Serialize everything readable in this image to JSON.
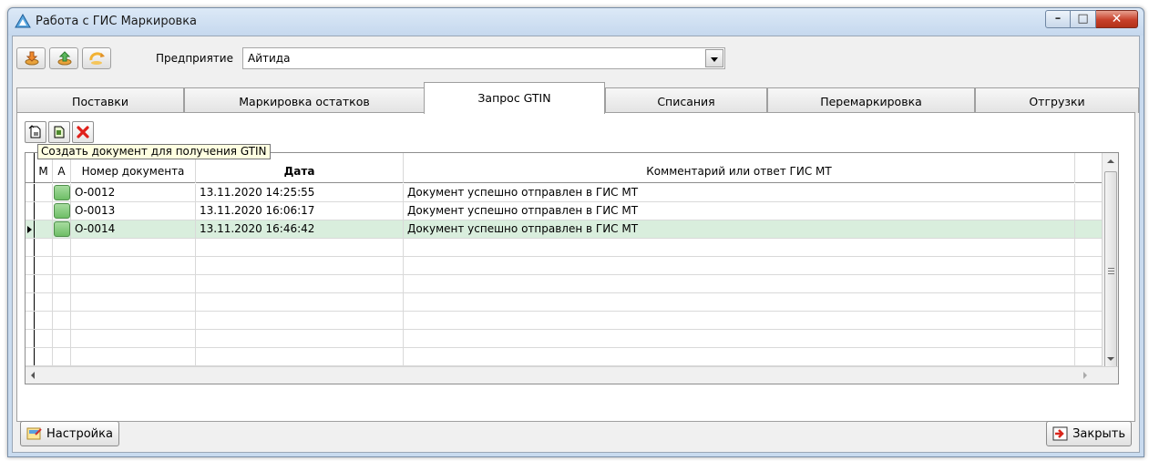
{
  "window": {
    "title": "Работа с ГИС Маркировка",
    "controls": [
      "minimize-icon",
      "maximize-icon",
      "close-icon"
    ]
  },
  "toolbar": {
    "buttons": [
      "download-icon",
      "upload-icon",
      "refresh-icon"
    ],
    "enterprise_label": "Предприятие",
    "enterprise_value": "Айтида"
  },
  "tabs": [
    {
      "label": "Поставки",
      "active": false
    },
    {
      "label": "Маркировка остатков",
      "active": false
    },
    {
      "label": "Запрос GTIN",
      "active": true
    },
    {
      "label": "Списания",
      "active": false
    },
    {
      "label": "Перемаркировка",
      "active": false
    },
    {
      "label": "Отгрузки",
      "active": false
    }
  ],
  "doc_toolbar": {
    "buttons": [
      "new-document-icon",
      "edit-document-icon",
      "delete-icon"
    ],
    "tooltip": "Создать документ для получения GTIN"
  },
  "grid": {
    "columns": {
      "m": "М",
      "a": "А",
      "number": "Номер документа",
      "date": "Дата",
      "comment": "Комментарий или ответ ГИС МТ"
    },
    "rows": [
      {
        "number": "О-0012",
        "date": "13.11.2020 14:25:55",
        "comment": "Документ успешно отправлен в ГИС МТ",
        "selected": false
      },
      {
        "number": "О-0013",
        "date": "13.11.2020 16:06:17",
        "comment": "Документ успешно отправлен в ГИС МТ",
        "selected": false
      },
      {
        "number": "О-0014",
        "date": "13.11.2020 16:46:42",
        "comment": "Документ успешно отправлен в ГИС МТ",
        "selected": true
      }
    ]
  },
  "footer": {
    "settings_label": "Настройка",
    "close_label": "Закрыть"
  },
  "colors": {
    "selected_row": "#d9eedd",
    "status_green": "#6ebe66",
    "tooltip_bg": "#ffffe1"
  }
}
